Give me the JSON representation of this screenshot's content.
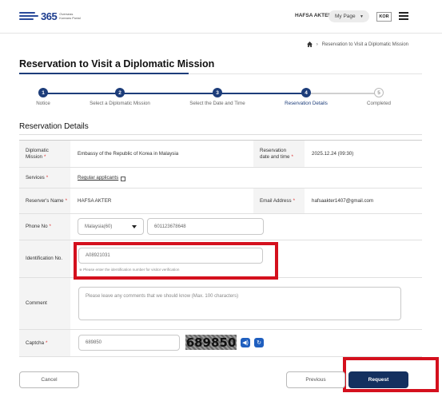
{
  "header": {
    "logo_number": "365",
    "logo_text_line1": "Overseas",
    "logo_text_line2": "Koreans Portal",
    "user_name": "HAFSA AKTER",
    "my_page_label": "My Page",
    "language": "KOR"
  },
  "breadcrumb": {
    "current": "Reservation to Visit a Diplomatic Mission"
  },
  "page_title": "Reservation to Visit a Diplomatic Mission",
  "stepper": {
    "steps": [
      {
        "number": "1",
        "label": "Notice",
        "status": "done"
      },
      {
        "number": "2",
        "label": "Select a Diplomatic Mission",
        "status": "done"
      },
      {
        "number": "3",
        "label": "Select the Date and Time",
        "status": "done"
      },
      {
        "number": "4",
        "label": "Reservation Details",
        "status": "current"
      },
      {
        "number": "5",
        "label": "Completed",
        "status": "todo"
      }
    ]
  },
  "section_title": "Reservation Details",
  "form": {
    "mission_label_1": "Diplomatic",
    "mission_label_2": "Mission",
    "mission_value": "Embassy of the Republic of Korea in Malaysia",
    "datetime_label_1": "Reservation",
    "datetime_label_2": "date and time",
    "datetime_value": "2025.12.24 (09:30)",
    "services_label": "Services",
    "services_value": "Regular applicants",
    "reserver_label": "Reserver's Name",
    "reserver_value": "HAFSA AKTER",
    "email_label": "Email Address",
    "email_value": "hafsaakter1407@gmail.com",
    "phone_label": "Phone No",
    "phone_country": "Malaysia(60)",
    "phone_number": "601123678648",
    "id_label": "Identification No.",
    "id_value": "A08921031",
    "id_hint": "※ Please enter the identification number for visitor verification",
    "comment_label": "Comment",
    "comment_placeholder": "Please leave any comments that we should know (Max. 100 characters)",
    "captcha_label": "Captcha",
    "captcha_input": "689850",
    "captcha_image_text": "689850",
    "required_mark": "*"
  },
  "buttons": {
    "cancel": "Cancel",
    "previous": "Previous",
    "request": "Request"
  },
  "colors": {
    "primary": "#14305f",
    "step_active": "#1d3d7a",
    "highlight": "#d4101d",
    "icon_button": "#1f5fbf"
  }
}
